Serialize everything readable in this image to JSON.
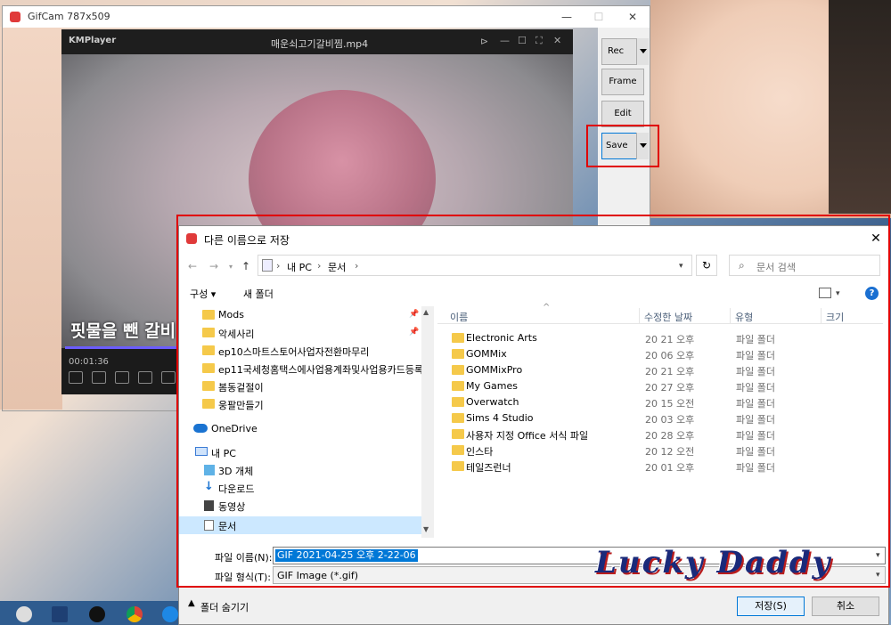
{
  "gifcam": {
    "title": "GifCam 787x509",
    "buttons": {
      "rec": "Rec",
      "frame": "Frame",
      "edit": "Edit",
      "save": "Save"
    }
  },
  "kmplayer": {
    "logo": "KMPlayer",
    "file": "매운쇠고기갈비찜.mp4",
    "subtitle": "핏물을 뺀 갈비",
    "time": "00:01:36",
    "progress": 0.23
  },
  "dialog": {
    "title": "다른 이름으로 저장",
    "close": "✕",
    "address": {
      "pc": "내 PC",
      "sep": "›",
      "folder": "문서"
    },
    "search_placeholder": "문서 검색",
    "toolbar": {
      "organize": "구성 ▾",
      "new_folder": "새 폴더"
    },
    "nav_items": [
      {
        "label": "Mods",
        "pinned": true
      },
      {
        "label": "악세사리",
        "pinned": true
      },
      {
        "label": "ep10스마트스토어사업자전환마무리",
        "pinned": false
      },
      {
        "label": "ep11국세청홈택스에사업용계좌및사업용카드등록",
        "pinned": false
      },
      {
        "label": "봄동겉절이",
        "pinned": false
      },
      {
        "label": "웅팔만들기",
        "pinned": false
      }
    ],
    "nav_onedrive": "OneDrive",
    "nav_thispc": "내 PC",
    "nav_pc_items": [
      "3D 개체",
      "다운로드",
      "동영상",
      "문서"
    ],
    "columns": {
      "name": "이름",
      "modified": "수정한 날짜",
      "type": "유형",
      "size": "크기"
    },
    "files": [
      {
        "name": "Electronic Arts",
        "date": "20 21 오후",
        "type": "파일 폴더"
      },
      {
        "name": "GOMMix",
        "date": "20 06 오후",
        "type": "파일 폴더"
      },
      {
        "name": "GOMMixPro",
        "date": "20 21 오후",
        "type": "파일 폴더"
      },
      {
        "name": "My Games",
        "date": "20 27 오후",
        "type": "파일 폴더"
      },
      {
        "name": "Overwatch",
        "date": "20 15 오전",
        "type": "파일 폴더"
      },
      {
        "name": "Sims 4 Studio",
        "date": "20 03 오후",
        "type": "파일 폴더"
      },
      {
        "name": "사용자 지정 Office 서식 파일",
        "date": "20 28 오후",
        "type": "파일 폴더"
      },
      {
        "name": "인스타",
        "date": "20 12 오전",
        "type": "파일 폴더"
      },
      {
        "name": "테일즈런너",
        "date": "20 01 오후",
        "type": "파일 폴더"
      }
    ],
    "filename_label": "파일 이름(N):",
    "filename_value": "GIF 2021-04-25 오후 2-22-06",
    "filetype_label": "파일 형식(T):",
    "filetype_value": "GIF Image (*.gif)",
    "hide_folders": "폴더 숨기기",
    "save_button": "저장(S)",
    "cancel_button": "취소"
  },
  "watermark": "Lucky Daddy",
  "colors": {
    "accent": "#0078d7",
    "highlight": "#e00000",
    "folder": "#f5c94a"
  },
  "icons": [
    "search-icon",
    "refresh-icon",
    "help-icon",
    "folder-icon",
    "onedrive-icon",
    "pc-icon",
    "pin-icon"
  ]
}
